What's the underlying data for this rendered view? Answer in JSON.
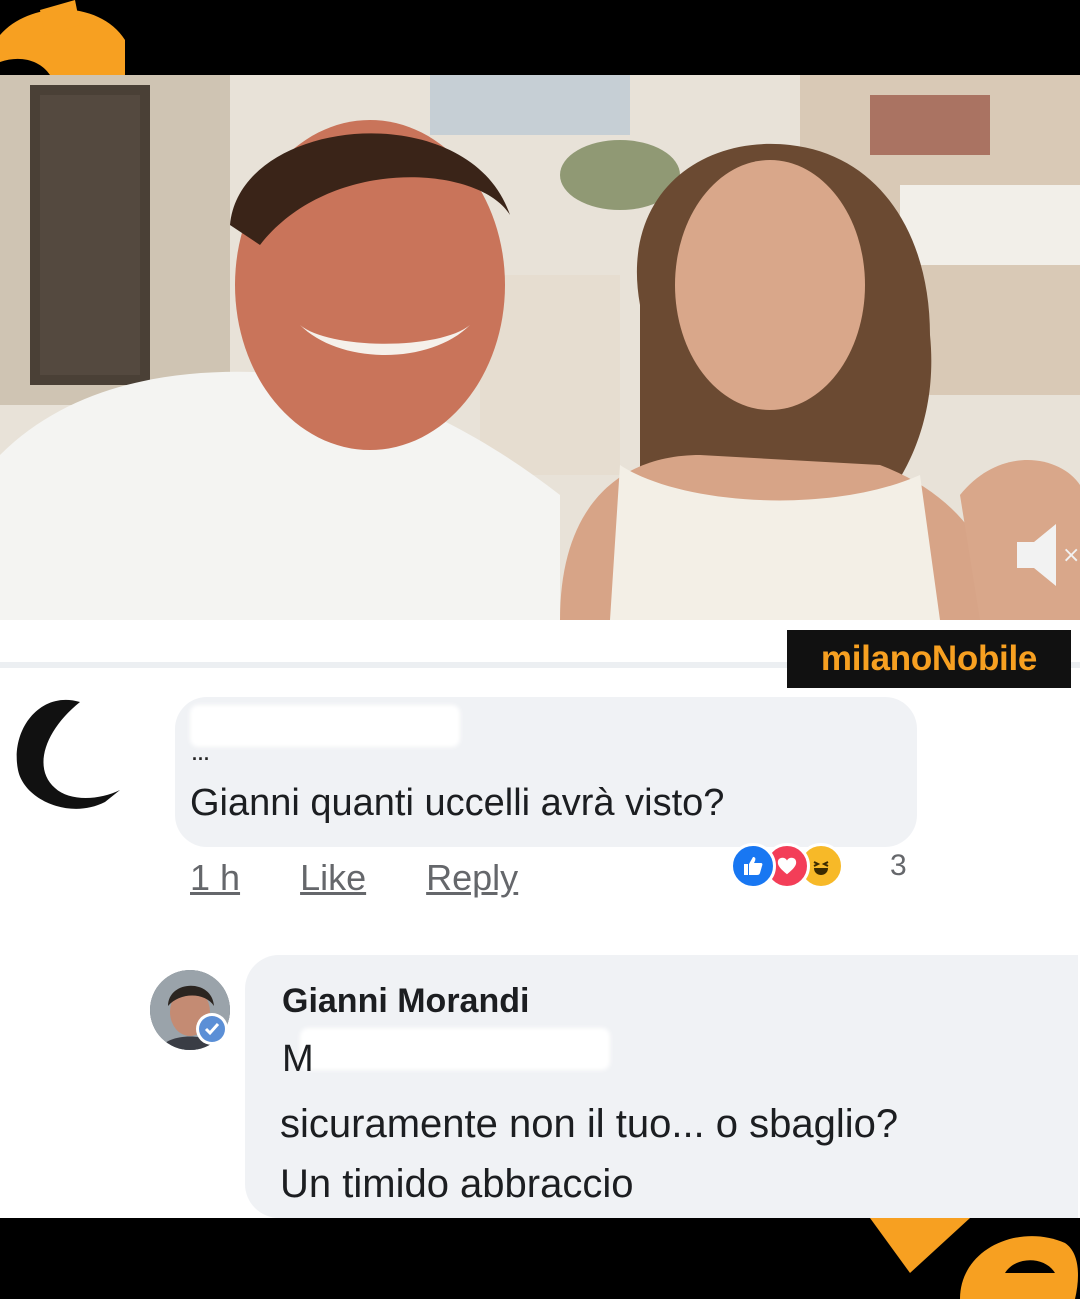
{
  "watermark": {
    "text": "milanoNobile",
    "color": "#f7a021"
  },
  "comment1": {
    "author_fragment": "...",
    "text": "Gianni quanti uccelli avrà visto?",
    "time": "1 h",
    "like_label": "Like",
    "reply_label": "Reply",
    "reaction_count": "3",
    "reactions": [
      "like-icon",
      "love-icon",
      "haha-icon"
    ]
  },
  "comment2": {
    "author": "Gianni Morandi",
    "verified": true,
    "mention_fragment": "M",
    "lines": [
      "sicuramente non il tuo... o sbaglio?",
      "Un timido abbraccio"
    ]
  },
  "colors": {
    "bubble": "#f0f2f5",
    "accent_orange": "#f7a021",
    "like_blue": "#1877f2",
    "love_red": "#f33e58",
    "haha_yellow": "#f7b928"
  }
}
